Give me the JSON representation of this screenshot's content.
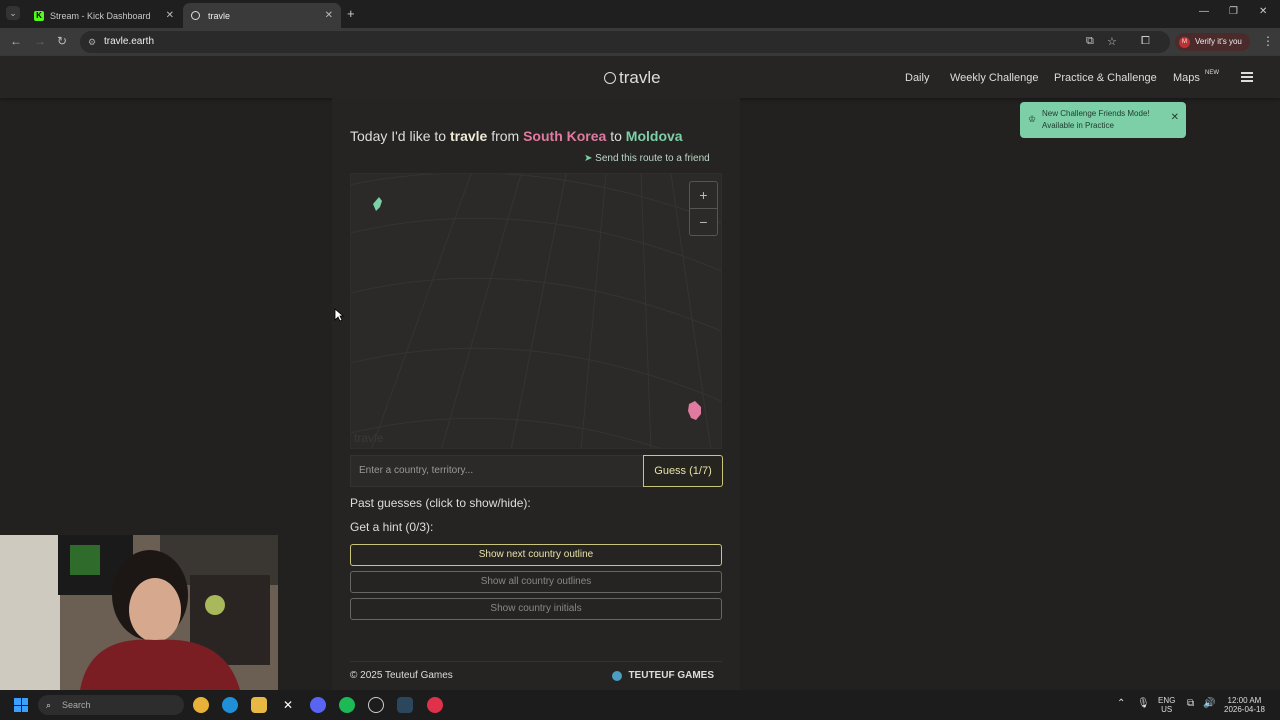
{
  "browser": {
    "tabs": [
      {
        "title": "Stream - Kick Dashboard"
      },
      {
        "title": "travle"
      }
    ],
    "url": "travle.earth",
    "verify_label": "Verify it's you",
    "profile_initial": "M"
  },
  "site": {
    "logo": "travle",
    "nav": [
      "Daily",
      "Weekly Challenge",
      "Practice & Challenge",
      "Maps"
    ],
    "nav_badge": "NEW",
    "toast": "New Challenge Friends Mode! Available in Practice",
    "headline": {
      "prefix": "Today I'd like to",
      "word": "travle",
      "from_word": "from",
      "from": "South Korea",
      "to_word": "to",
      "to": "Moldova"
    },
    "send_route": "Send this route to a friend",
    "map": {
      "zoom_in": "+",
      "zoom_out": "−",
      "watermark": "travle"
    },
    "guess": {
      "placeholder": "Enter a country, territory...",
      "button": "Guess (1/7)"
    },
    "past_guesses": "Past guesses (click to show/hide):",
    "hint_title": "Get a hint (0/3):",
    "hints": [
      "Show next country outline",
      "Show all country outlines",
      "Show country initials"
    ],
    "footer": {
      "copyright": "© 2025 Teuteuf Games",
      "brand": "TEUTEUF GAMES"
    }
  },
  "taskbar": {
    "search_placeholder": "Search",
    "lang": "ENG",
    "region": "US",
    "time": "12:00 AM",
    "date": "2026-04-18"
  }
}
